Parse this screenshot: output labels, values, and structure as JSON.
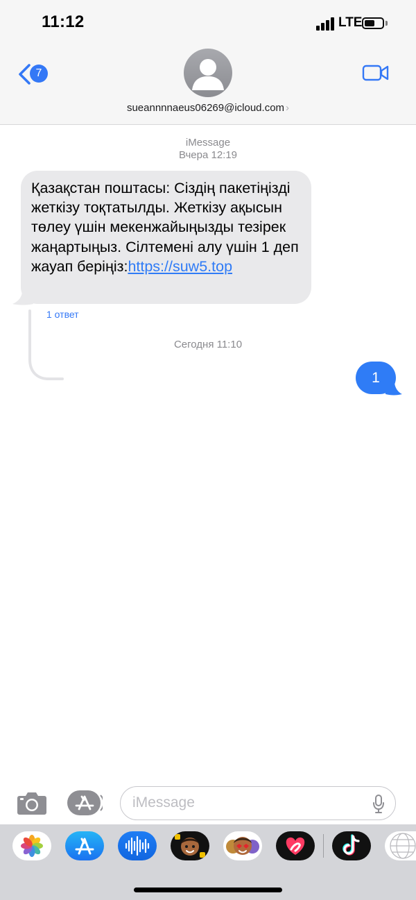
{
  "status_bar": {
    "time": "11:12",
    "network": "LTE",
    "battery_level": 0.6
  },
  "header": {
    "back_badge_count": "7",
    "contact": "sueannnnaeus06269@icloud.com",
    "contact_chevron": "›",
    "icons": [
      "chevron-left-icon",
      "person-icon",
      "video-camera-icon"
    ]
  },
  "conversation": {
    "service": "iMessage",
    "timestamp_1": "Вчера 12:19",
    "incoming": {
      "text": "Қазақстан поштасы: Сіздің пакетіңізді жеткізу тоқтатылды. Жеткізу ақысын төлеу үшін мекенжайыңызды тезірек жаңартыңыз. Сілтемені алу үшін 1 деп жауап беріңіз:",
      "link": "https://suw5.top"
    },
    "reply_count": "1 ответ",
    "timestamp_2": "Сегодня 11:10",
    "outgoing": {
      "text": "1"
    }
  },
  "input_bar": {
    "placeholder": "iMessage",
    "icons": [
      "camera-icon",
      "app-store-icon",
      "microphone-icon"
    ]
  },
  "app_drawer": {
    "apps": [
      "photos-icon",
      "app-store-icon",
      "audio-message-icon",
      "memoji-icon",
      "animoji-icon",
      "digital-touch-icon",
      "tiktok-icon",
      "globe-icon"
    ]
  },
  "colors": {
    "accent": "#3478f6",
    "incoming_bubble": "#e9e9eb",
    "outgoing_bubble": "#2f7cf6"
  }
}
